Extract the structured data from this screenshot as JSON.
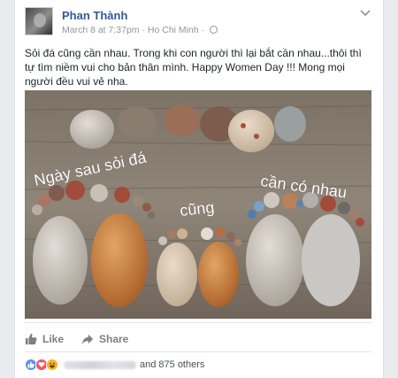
{
  "post": {
    "author": "Phan Thành",
    "date": "March 8 at 7:37pm",
    "separator": "·",
    "location": "Ho Chi Minh",
    "text": "Sỏi đá cũng cần nhau. Trong khi con người thì lại bắt cần nhau...thôi thì tự tìm niềm vui cho bản thân mình. Happy Women Day !!! Mong mọi người đều vui vẻ nha.",
    "photo_text": {
      "left": "Ngày sau sỏi đá",
      "middle": "cũng",
      "right": "cần có nhau"
    }
  },
  "actions": {
    "like_label": "Like",
    "share_label": "Share"
  },
  "reactions": {
    "others_text": "and 875 others"
  },
  "icons": {
    "options": "chevron-down-icon",
    "privacy": "globe-icon",
    "like": "thumbs-up-icon",
    "share": "share-arrow-icon",
    "reaction_like": "like-reaction-icon",
    "reaction_love": "love-reaction-icon",
    "reaction_haha": "haha-reaction-icon"
  },
  "colors": {
    "author_link": "#365899",
    "meta_text": "#90949c",
    "action_text": "#7f7f7f",
    "like_blue": "#5890ff",
    "love_red": "#f25268",
    "haha_yellow": "#f7b125"
  }
}
